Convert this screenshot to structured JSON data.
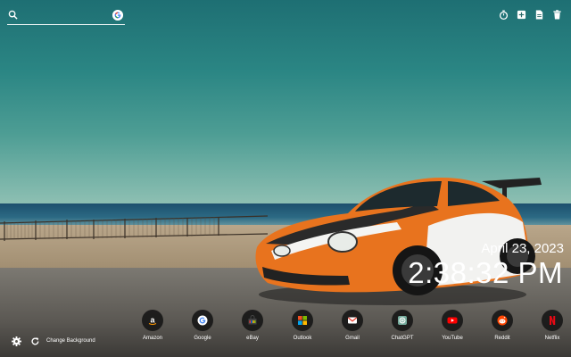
{
  "search": {
    "placeholder": "",
    "search_icon": "search-icon",
    "google_icon": "google-g-icon"
  },
  "toolbar": {
    "icons": [
      "timer-icon",
      "grid-add-icon",
      "document-icon",
      "trash-icon"
    ]
  },
  "clock": {
    "date": "April 23, 2023",
    "time": "2:38:32 PM"
  },
  "bottom_left": {
    "settings_icon": "gear-icon",
    "refresh_icon": "refresh-icon",
    "change_background_label": "Change Background"
  },
  "shortcuts": [
    {
      "label": "Amazon",
      "icon": "amazon-icon",
      "color": "#ffffff"
    },
    {
      "label": "Google",
      "icon": "google-icon",
      "color": "#4285f4"
    },
    {
      "label": "eBay",
      "icon": "ebay-icon",
      "color": "#e53238"
    },
    {
      "label": "Outlook",
      "icon": "outlook-icon",
      "color": "#0078d4"
    },
    {
      "label": "Gmail",
      "icon": "gmail-icon",
      "color": "#ea4335"
    },
    {
      "label": "ChatGPT",
      "icon": "chatgpt-icon",
      "color": "#74aa9c"
    },
    {
      "label": "YouTube",
      "icon": "youtube-icon",
      "color": "#ff0000"
    },
    {
      "label": "Reddit",
      "icon": "reddit-icon",
      "color": "#ff4500"
    },
    {
      "label": "Netflix",
      "icon": "netflix-icon",
      "color": "#e50914"
    }
  ]
}
